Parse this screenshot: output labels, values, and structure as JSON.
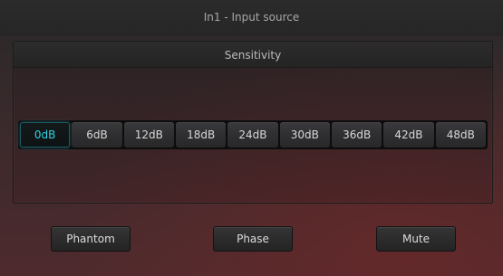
{
  "window": {
    "title": "In1 - Input source"
  },
  "sensitivity": {
    "title": "Sensitivity",
    "selected": "0dB",
    "options": [
      "0dB",
      "6dB",
      "12dB",
      "18dB",
      "24dB",
      "30dB",
      "36dB",
      "42dB",
      "48dB"
    ]
  },
  "actions": {
    "phantom_label": "Phantom",
    "phase_label": "Phase",
    "mute_label": "Mute"
  },
  "colors": {
    "selected_text": "#2fd3e3"
  }
}
